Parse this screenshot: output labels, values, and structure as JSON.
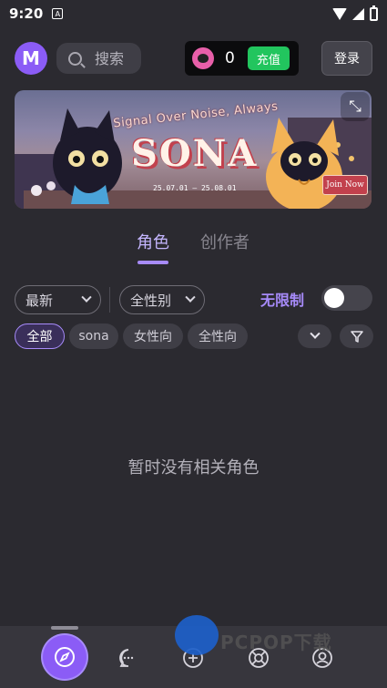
{
  "status_bar": {
    "time": "9:20",
    "notification": "A"
  },
  "header": {
    "logo": "M",
    "search_placeholder": "搜索",
    "coin_count": "0",
    "recharge_label": "充值",
    "login_label": "登录"
  },
  "banner": {
    "tagline": "Signal Over Noise, Always",
    "title": "SONA",
    "dates": "25.07.01 — 25.08.01",
    "join_label": "Join Now"
  },
  "tabs": {
    "active": "角色",
    "inactive": "创作者"
  },
  "filters": {
    "sort_value": "最新",
    "gender_value": "全性别",
    "unlimited_label": "无限制",
    "unlimited_on": false
  },
  "chips": [
    "全部",
    "sona",
    "女性向",
    "全性向"
  ],
  "empty_message": "暂时没有相关角色",
  "nav": [
    "discover",
    "chat",
    "create",
    "support",
    "profile"
  ],
  "watermark": "PCPOP下载",
  "colors": {
    "accent": "#8b5cf6",
    "recharge": "#22c55e",
    "background": "#2b2a30"
  }
}
